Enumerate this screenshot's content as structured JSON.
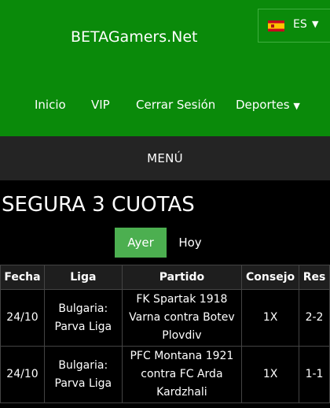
{
  "header": {
    "site_title": "BETAGamers.Net",
    "language": {
      "code": "ES",
      "flag_icon": "spain-flag-icon"
    }
  },
  "nav": [
    {
      "label": "Inicio"
    },
    {
      "label": "VIP"
    },
    {
      "label": "Cerrar Sesión"
    },
    {
      "label": "Deportes"
    }
  ],
  "menu_label": "MENÚ",
  "page_title": "SEGURA 3 CUOTAS",
  "day_tabs": {
    "yesterday": "Ayer",
    "today": "Hoy",
    "active": "Ayer"
  },
  "table": {
    "headers": [
      "Fecha",
      "Liga",
      "Partido",
      "Consejo",
      "Res"
    ],
    "rows": [
      {
        "fecha": "24/10",
        "liga": "Bulgaria: Parva Liga",
        "partido": "FK Spartak 1918 Varna contra Botev Plovdiv",
        "consejo": "1X",
        "res": "2-2"
      },
      {
        "fecha": "24/10",
        "liga": "Bulgaria: Parva Liga",
        "partido": "PFC Montana 1921 contra FC Arda Kardzhali",
        "consejo": "1X",
        "res": "1-1"
      }
    ]
  },
  "colors": {
    "header_green": "#0a8a0a",
    "active_tab": "#4caf50",
    "menu_bar": "#242424"
  }
}
